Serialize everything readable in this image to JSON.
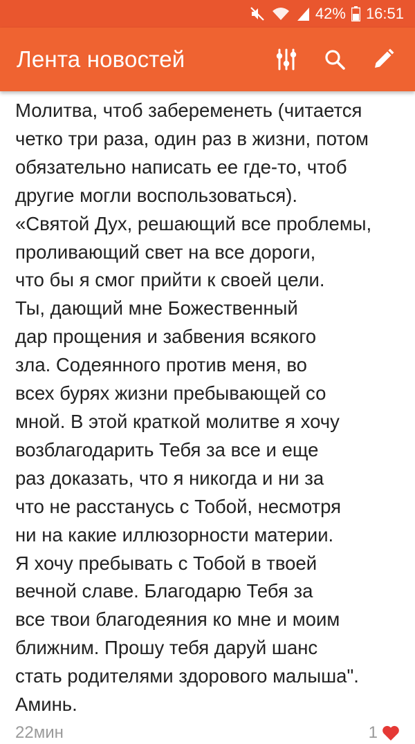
{
  "status_bar": {
    "battery": "42%",
    "time": "16:51",
    "icons": [
      "mute-icon",
      "wifi-icon",
      "signal-icon",
      "battery-icon"
    ]
  },
  "app_bar": {
    "title": "Лента новостей",
    "actions": [
      "filter-icon",
      "search-icon",
      "edit-icon"
    ]
  },
  "post": {
    "lines": [
      "Молитва, чтоб забеременеть (читается",
      "четко три раза, один раз в жизни, потом",
      "обязательно написать ее где-то, чтоб",
      "другие могли воспользоваться).",
      "«Святой Дух, решающий все проблемы,",
      "проливающий свет на все дороги,",
      "что бы я смог прийти к своей цели.",
      "Ты, дающий мне Божественный",
      "дар прощения и забвения всякого",
      "зла. Содеянного против меня, во",
      "всех бурях жизни пребывающей со",
      "мной. В этой краткой молитве я хочу",
      "возблагодарить Тебя за все и еще",
      "раз доказать, что я никогда и ни за",
      "что не расстанусь с Тобой, несмотря",
      "ни на какие иллюзорности материи.",
      "Я хочу пребывать с Тобой в твоей",
      "вечной славе. Благодарю Тебя за",
      "все твои благодеяния ко мне и моим",
      "ближним. Прошу тебя даруй шанс",
      "стать родителями здорового малыша\".",
      "Аминь."
    ],
    "time_ago": "22мин",
    "likes": "1"
  },
  "colors": {
    "status_bar": "#e9562e",
    "app_bar": "#ef6331",
    "text": "#222222",
    "heart": "#e53935"
  }
}
